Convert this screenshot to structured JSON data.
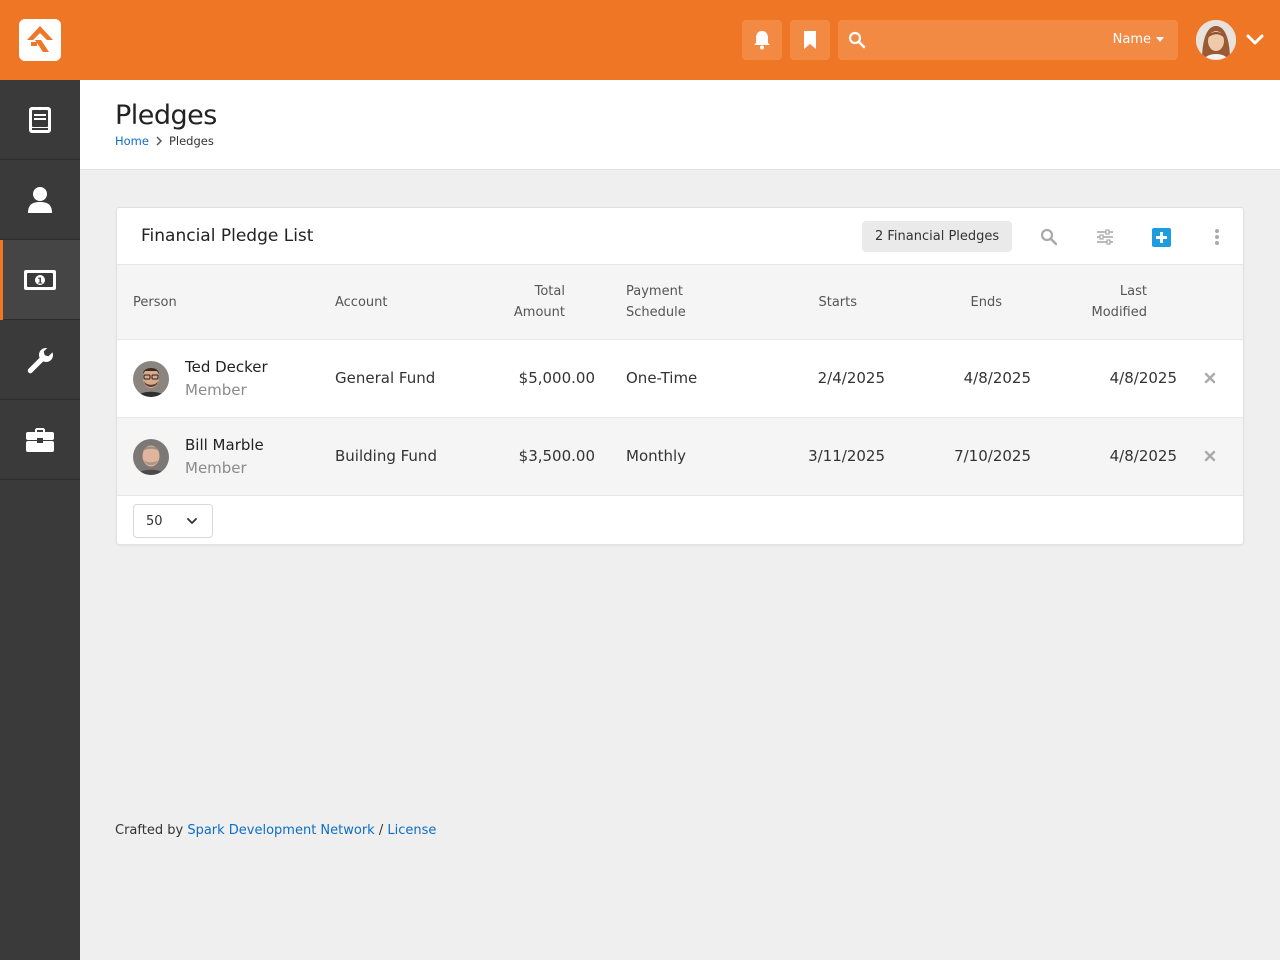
{
  "topbar": {
    "search_value": "",
    "search_scope": "Name",
    "icons": [
      "rock-logo-icon",
      "bell-icon",
      "bookmark-icon",
      "search-icon",
      "chevron-down-icon"
    ]
  },
  "sidebar": {
    "items": [
      {
        "icon": "book-icon"
      },
      {
        "icon": "person-icon"
      },
      {
        "icon": "money-icon",
        "active": true
      },
      {
        "icon": "wrench-icon"
      },
      {
        "icon": "briefcase-icon"
      }
    ]
  },
  "header": {
    "title": "Pledges",
    "breadcrumb": {
      "home": "Home",
      "current": "Pledges"
    }
  },
  "card": {
    "title": "Financial Pledge List",
    "count_badge": "2 Financial Pledges",
    "columns": {
      "person": "Person",
      "account": "Account",
      "total_amount_1": "Total",
      "total_amount_2": "Amount",
      "payment_schedule_1": "Payment",
      "payment_schedule_2": "Schedule",
      "starts": "Starts",
      "ends": "Ends",
      "last_modified_1": "Last",
      "last_modified_2": "Modified"
    },
    "rows": [
      {
        "name": "Ted Decker",
        "role": "Member",
        "account": "General Fund",
        "amount": "$5,000.00",
        "schedule": "One-Time",
        "starts": "2/4/2025",
        "ends": "4/8/2025",
        "modified": "4/8/2025"
      },
      {
        "name": "Bill Marble",
        "role": "Member",
        "account": "Building Fund",
        "amount": "$3,500.00",
        "schedule": "Monthly",
        "starts": "3/11/2025",
        "ends": "7/10/2025",
        "modified": "4/8/2025"
      }
    ],
    "page_size": "50"
  },
  "footer": {
    "prefix": "Crafted by",
    "link1": "Spark Development Network",
    "sep": "/",
    "link2": "License"
  },
  "colors": {
    "brand": "#ee7624",
    "sidebar": "#3a3a3a",
    "link": "#0e6ec7",
    "add_button": "#1d9ce0"
  }
}
